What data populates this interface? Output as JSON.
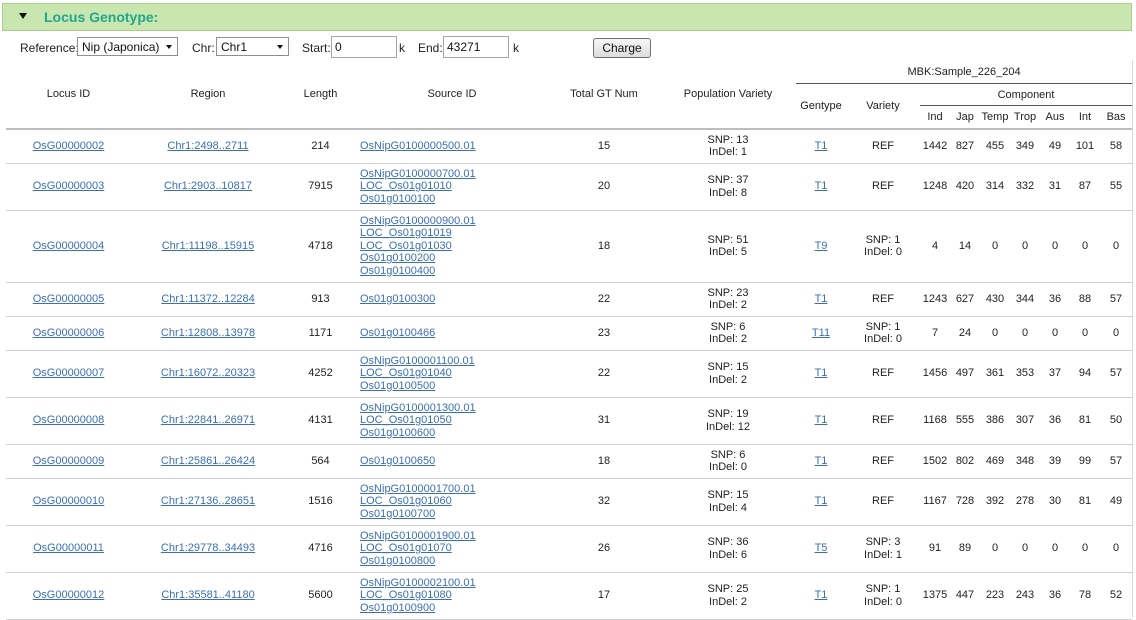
{
  "panel": {
    "title": "Locus Genotype:"
  },
  "toolbar": {
    "reference_label": "Reference:",
    "reference_value": "Nip (Japonica)",
    "chr_label": "Chr:",
    "chr_value": "Chr1",
    "start_label": "Start:",
    "start_value": "0",
    "start_unit": "k",
    "end_label": "End:",
    "end_value": "43271",
    "end_unit": "k",
    "charge_label": "Charge"
  },
  "table": {
    "headers": {
      "locus_id": "Locus ID",
      "region": "Region",
      "length": "Length",
      "source_id": "Source ID",
      "total_gt": "Total GT Num",
      "pop_variety": "Population Variety",
      "sample": "MBK:Sample_226_204",
      "gentype": "Gentype",
      "variety": "Variety",
      "component": "Component",
      "comp_cols": [
        "Ind",
        "Jap",
        "Temp",
        "Trop",
        "Aus",
        "Int",
        "Bas"
      ]
    },
    "rows": [
      {
        "locus": "OsG00000002",
        "region": "Chr1:2498..2711",
        "length": "214",
        "source": [
          "OsNipG0100000500.01"
        ],
        "total": "15",
        "snp": "SNP: 13",
        "indel": "InDel: 1",
        "gentype": "T1",
        "variety": [
          "REF"
        ],
        "comp": [
          "1442",
          "827",
          "455",
          "349",
          "49",
          "101",
          "58"
        ]
      },
      {
        "locus": "OsG00000003",
        "region": "Chr1:2903..10817",
        "length": "7915",
        "source": [
          "OsNipG0100000700.01",
          "LOC_Os01g01010",
          "Os01g0100100"
        ],
        "total": "20",
        "snp": "SNP: 37",
        "indel": "InDel: 8",
        "gentype": "T1",
        "variety": [
          "REF"
        ],
        "comp": [
          "1248",
          "420",
          "314",
          "332",
          "31",
          "87",
          "55"
        ]
      },
      {
        "locus": "OsG00000004",
        "region": "Chr1:11198..15915",
        "length": "4718",
        "source": [
          "OsNipG0100000900.01",
          "LOC_Os01g01019",
          "LOC_Os01g01030",
          "Os01g0100200",
          "Os01g0100400"
        ],
        "total": "18",
        "snp": "SNP: 51",
        "indel": "InDel: 5",
        "gentype": "T9",
        "variety": [
          "SNP: 1",
          "InDel: 0"
        ],
        "comp": [
          "4",
          "14",
          "0",
          "0",
          "0",
          "0",
          "0"
        ]
      },
      {
        "locus": "OsG00000005",
        "region": "Chr1:11372..12284",
        "length": "913",
        "source": [
          "Os01g0100300"
        ],
        "total": "22",
        "snp": "SNP: 23",
        "indel": "InDel: 2",
        "gentype": "T1",
        "variety": [
          "REF"
        ],
        "comp": [
          "1243",
          "627",
          "430",
          "344",
          "36",
          "88",
          "57"
        ]
      },
      {
        "locus": "OsG00000006",
        "region": "Chr1:12808..13978",
        "length": "1171",
        "source": [
          "Os01g0100466"
        ],
        "total": "23",
        "snp": "SNP: 6",
        "indel": "InDel: 2",
        "gentype": "T11",
        "variety": [
          "SNP: 1",
          "InDel: 0"
        ],
        "comp": [
          "7",
          "24",
          "0",
          "0",
          "0",
          "0",
          "0"
        ]
      },
      {
        "locus": "OsG00000007",
        "region": "Chr1:16072..20323",
        "length": "4252",
        "source": [
          "OsNipG0100001100.01",
          "LOC_Os01g01040",
          "Os01g0100500"
        ],
        "total": "22",
        "snp": "SNP: 15",
        "indel": "InDel: 2",
        "gentype": "T1",
        "variety": [
          "REF"
        ],
        "comp": [
          "1456",
          "497",
          "361",
          "353",
          "37",
          "94",
          "57"
        ]
      },
      {
        "locus": "OsG00000008",
        "region": "Chr1:22841..26971",
        "length": "4131",
        "source": [
          "OsNipG0100001300.01",
          "LOC_Os01g01050",
          "Os01g0100600"
        ],
        "total": "31",
        "snp": "SNP: 19",
        "indel": "InDel: 12",
        "gentype": "T1",
        "variety": [
          "REF"
        ],
        "comp": [
          "1168",
          "555",
          "386",
          "307",
          "36",
          "81",
          "50"
        ]
      },
      {
        "locus": "OsG00000009",
        "region": "Chr1:25861..26424",
        "length": "564",
        "source": [
          "Os01g0100650"
        ],
        "total": "18",
        "snp": "SNP: 6",
        "indel": "InDel: 0",
        "gentype": "T1",
        "variety": [
          "REF"
        ],
        "comp": [
          "1502",
          "802",
          "469",
          "348",
          "39",
          "99",
          "57"
        ]
      },
      {
        "locus": "OsG00000010",
        "region": "Chr1:27136..28651",
        "length": "1516",
        "source": [
          "OsNipG0100001700.01",
          "LOC_Os01g01060",
          "Os01g0100700"
        ],
        "total": "32",
        "snp": "SNP: 15",
        "indel": "InDel: 4",
        "gentype": "T1",
        "variety": [
          "REF"
        ],
        "comp": [
          "1167",
          "728",
          "392",
          "278",
          "30",
          "81",
          "49"
        ]
      },
      {
        "locus": "OsG00000011",
        "region": "Chr1:29778..34493",
        "length": "4716",
        "source": [
          "OsNipG0100001900.01",
          "LOC_Os01g01070",
          "Os01g0100800"
        ],
        "total": "26",
        "snp": "SNP: 36",
        "indel": "InDel: 6",
        "gentype": "T5",
        "variety": [
          "SNP: 3",
          "InDel: 1"
        ],
        "comp": [
          "91",
          "89",
          "0",
          "0",
          "0",
          "0",
          "0"
        ]
      },
      {
        "locus": "OsG00000012",
        "region": "Chr1:35581..41180",
        "length": "5600",
        "source": [
          "OsNipG0100002100.01",
          "LOC_Os01g01080",
          "Os01g0100900"
        ],
        "total": "17",
        "snp": "SNP: 25",
        "indel": "InDel: 2",
        "gentype": "T1",
        "variety": [
          "SNP: 1",
          "InDel: 0"
        ],
        "comp": [
          "1375",
          "447",
          "223",
          "243",
          "36",
          "78",
          "52"
        ]
      }
    ]
  }
}
